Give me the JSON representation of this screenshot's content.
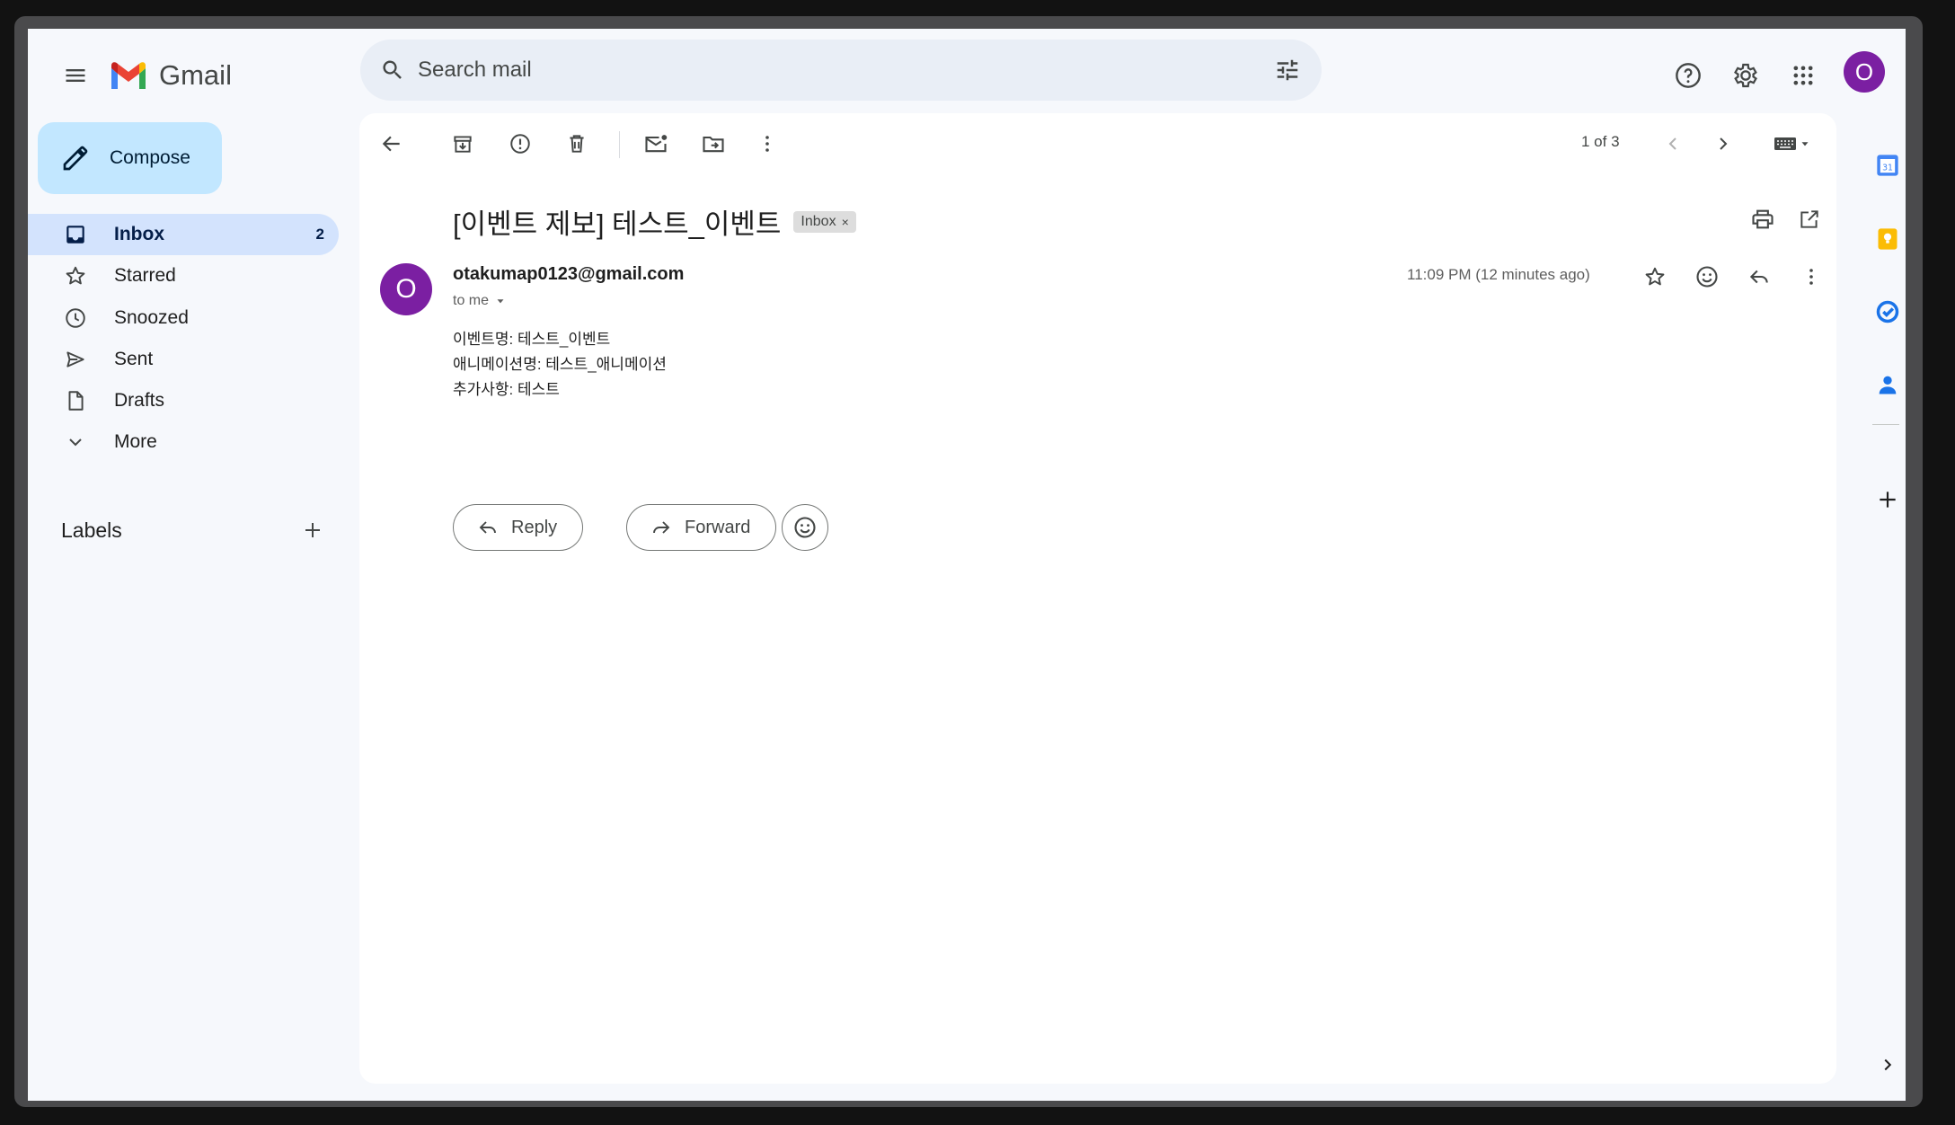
{
  "app": {
    "name": "Gmail"
  },
  "search": {
    "placeholder": "Search mail"
  },
  "account": {
    "avatar_letter": "O",
    "avatar_color": "#7b1fa2"
  },
  "sidebar": {
    "compose_label": "Compose",
    "items": [
      {
        "label": "Inbox",
        "count": "2",
        "icon": "inbox-icon",
        "active": true
      },
      {
        "label": "Starred",
        "icon": "star-icon"
      },
      {
        "label": "Snoozed",
        "icon": "clock-icon"
      },
      {
        "label": "Sent",
        "icon": "send-icon"
      },
      {
        "label": "Drafts",
        "icon": "draft-icon"
      },
      {
        "label": "More",
        "icon": "chevron-down-icon"
      }
    ],
    "labels_title": "Labels"
  },
  "toolbar": {
    "pager": "1 of 3"
  },
  "email": {
    "subject": "[이벤트 제보] 테스트_이벤트",
    "chip_label": "Inbox",
    "chip_close": "×",
    "sender": "otakumap0123@gmail.com",
    "sender_initial": "O",
    "to": "to me",
    "time": "11:09 PM (12 minutes ago)",
    "body_lines": [
      "이벤트명: 테스트_이벤트",
      "애니메이션명: 테스트_애니메이션",
      "추가사항: 테스트"
    ]
  },
  "actions": {
    "reply_label": "Reply",
    "forward_label": "Forward"
  },
  "colors": {
    "accent": "#c2e7ff",
    "active_nav": "#d3e3fd",
    "search_bg": "#e9eef6",
    "app_bg": "#f6f8fc"
  }
}
